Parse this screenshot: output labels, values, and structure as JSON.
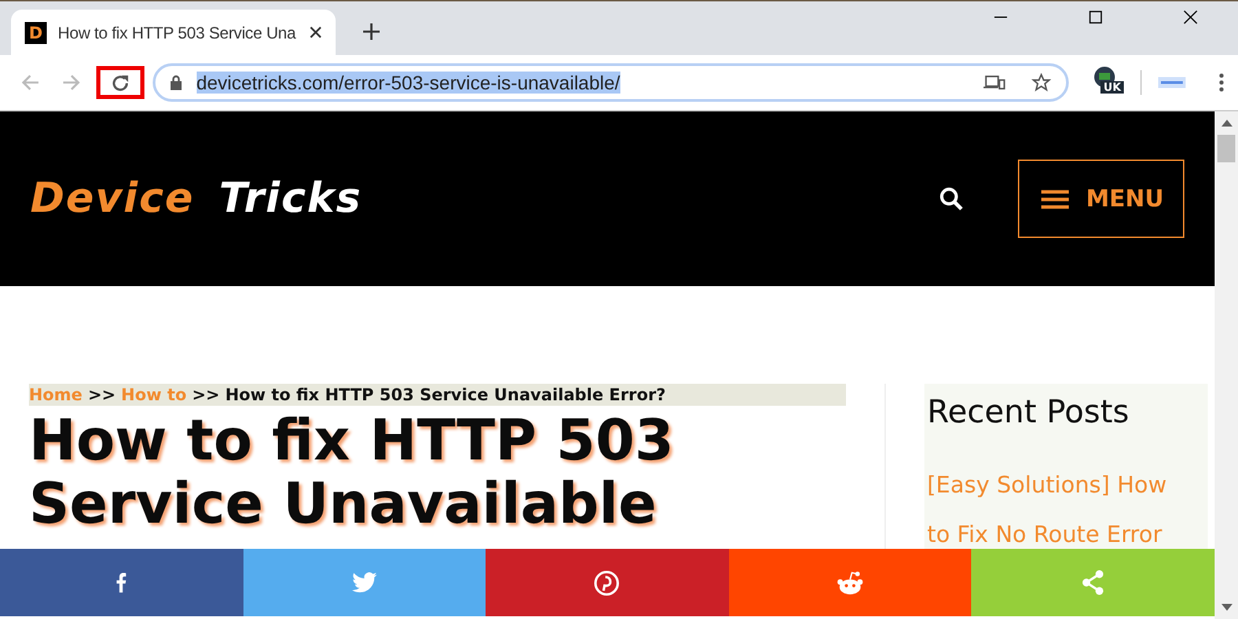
{
  "tab": {
    "favicon": "D",
    "title": "How to fix HTTP 503 Service Una",
    "selected": true
  },
  "toolbar": {
    "reload_highlighted": true,
    "url": "devicetricks.com/error-503-service-is-unavailable/",
    "url_selected": true,
    "extension_badge": "UK"
  },
  "site_header": {
    "logo_first": "Device",
    "logo_second": "Tricks",
    "menu_label": "MENU"
  },
  "breadcrumb": [
    {
      "text": "Home",
      "kind": "link"
    },
    {
      "text": ">>",
      "kind": "sep"
    },
    {
      "text": "How to",
      "kind": "link"
    },
    {
      "text": ">>",
      "kind": "sep"
    },
    {
      "text": "How to fix HTTP 503 Service Unavailable Error?",
      "kind": "current"
    }
  ],
  "article_title": "How to fix HTTP 503 Service Unavailable",
  "sidebar": {
    "heading": "Recent Posts",
    "posts": [
      "[Easy Solutions] How",
      "to Fix No Route Error"
    ]
  },
  "share_bar": [
    {
      "kind": "facebook",
      "color": "#3b5998"
    },
    {
      "kind": "twitter",
      "color": "#55acee"
    },
    {
      "kind": "pinterest",
      "color": "#cb2027"
    },
    {
      "kind": "reddit",
      "color": "#ff4500"
    },
    {
      "kind": "share",
      "color": "#95cf3a"
    }
  ]
}
